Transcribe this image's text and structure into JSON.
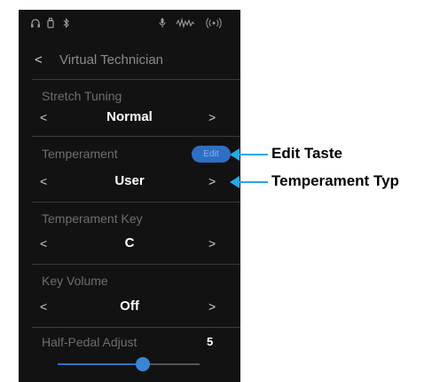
{
  "status_bar": {
    "icons": [
      "headphones-icon",
      "usb-icon",
      "bluetooth-icon",
      "microphone-icon",
      "waveform-icon",
      "wireless-icon"
    ]
  },
  "header": {
    "back_glyph": "<",
    "title": "Virtual Technician"
  },
  "settings": [
    {
      "label": "Stretch Tuning",
      "value": "Normal"
    },
    {
      "label": "Temperament",
      "value": "User",
      "edit_button": "Edit"
    },
    {
      "label": "Temperament Key",
      "value": "C"
    },
    {
      "label": "Key Volume",
      "value": "Off"
    }
  ],
  "half_pedal": {
    "label": "Half-Pedal Adjust",
    "value": "5",
    "level_fraction": 0.6
  },
  "arrows": {
    "left": "<",
    "right": ">"
  },
  "callouts": {
    "edit": "Edit Taste",
    "type": "Temperament Typ"
  },
  "colors": {
    "accent": "#2e6fc4",
    "callout": "#27a9e1",
    "background": "#121212"
  }
}
